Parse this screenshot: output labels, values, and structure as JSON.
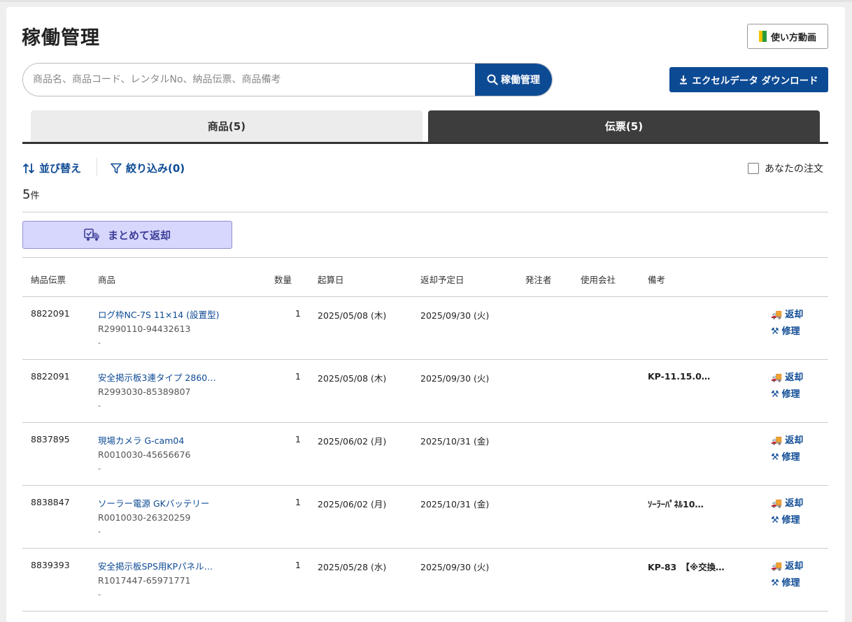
{
  "page": {
    "title": "稼働管理"
  },
  "header": {
    "howto_label": "使い方動画"
  },
  "search": {
    "placeholder": "商品名、商品コード、レンタルNo、納品伝票、商品備考",
    "button_label": "稼働管理"
  },
  "excel": {
    "label": "エクセルデータ ダウンロード"
  },
  "tabs": [
    {
      "label": "商品(5)"
    },
    {
      "label": "伝票(5)"
    }
  ],
  "toolbar": {
    "sort_label": "並び替え",
    "filter_label": "絞り込み(0)",
    "mine_label": "あなたの注文"
  },
  "result": {
    "count": "5",
    "unit": "件"
  },
  "bulk": {
    "label": "まとめて返却"
  },
  "table": {
    "headers": [
      "納品伝票",
      "商品",
      "数量",
      "起算日",
      "返却予定日",
      "発注者",
      "使用会社",
      "備考"
    ],
    "rows": [
      {
        "slip": "8822091",
        "product": "ログ枠NC-7S 11×14 (設置型)",
        "code": "R2990110-94432613",
        "sub": "-",
        "qty": "1",
        "start": "2025/05/08 (木)",
        "return": "2025/09/30 (火)",
        "orderer": "",
        "company": "",
        "note": ""
      },
      {
        "slip": "8822091",
        "product": "安全掲示板3連タイプ 2860…",
        "code": "R2993030-85389807",
        "sub": "-",
        "qty": "1",
        "start": "2025/05/08 (木)",
        "return": "2025/09/30 (火)",
        "orderer": "",
        "company": "",
        "note": "KP-11.15.0…"
      },
      {
        "slip": "8837895",
        "product": "現場カメラ G-cam04",
        "code": "R0010030-45656676",
        "sub": "-",
        "qty": "1",
        "start": "2025/06/02 (月)",
        "return": "2025/10/31 (金)",
        "orderer": "",
        "company": "",
        "note": ""
      },
      {
        "slip": "8838847",
        "product": "ソーラー電源 GKバッテリー",
        "code": "R0010030-26320259",
        "sub": "-",
        "qty": "1",
        "start": "2025/06/02 (月)",
        "return": "2025/10/31 (金)",
        "orderer": "",
        "company": "",
        "note": "ｿｰﾗｰﾊﾟﾈﾙ10…"
      },
      {
        "slip": "8839393",
        "product": "安全掲示板SPS用KPパネル…",
        "code": "R1017447-65971771",
        "sub": "-",
        "qty": "1",
        "start": "2025/05/28 (水)",
        "return": "2025/09/30 (火)",
        "orderer": "",
        "company": "",
        "note": "KP-83　【※交換…"
      }
    ],
    "actions": {
      "return_label": "返却",
      "repair_label": "修理"
    }
  },
  "colors": {
    "primary": "#0d4a94",
    "tab_active": "#3d3d3d",
    "bulk_bg": "#d7d7fd"
  }
}
